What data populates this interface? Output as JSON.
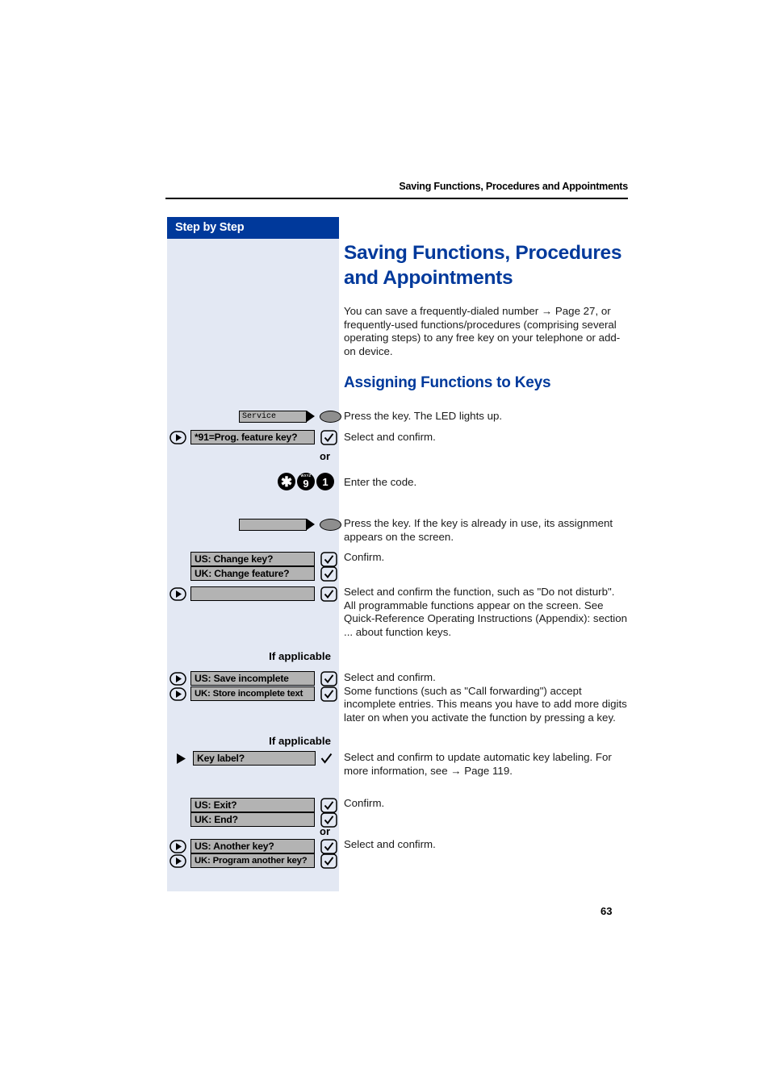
{
  "page": {
    "running_head": "Saving Functions, Procedures and Appointments",
    "number": "63",
    "colors": {
      "accent_blue": "#00399B",
      "sidebar_bg": "#E3E8F3",
      "display_gray": "#B3B3B3"
    }
  },
  "sidebar": {
    "header_label": "Step by Step",
    "or_1": "or",
    "or_2": "or",
    "if_applicable_1": "If applicable",
    "if_applicable_2": "If applicable",
    "service_key_label": "Service",
    "rows": {
      "prog_feature_key": "*91=Prog. feature key?",
      "blank_key": "",
      "us_change_key": "US: Change key?",
      "uk_change_feature": "UK: Change feature?",
      "blank_function": "",
      "us_save_incomplete": "US: Save incomplete",
      "uk_store_incomplete_text": "UK: Store incomplete text",
      "key_label": "Key label?",
      "us_exit": "US: Exit?",
      "uk_end": "UK: End?",
      "us_another_key": "US: Another key?",
      "uk_program_another_key": "UK: Program another key?"
    },
    "dial_keys": [
      {
        "glyph": "✱",
        "sup": ""
      },
      {
        "glyph": "9",
        "sup": "WXYZ"
      },
      {
        "glyph": "1",
        "sup": ""
      }
    ]
  },
  "main": {
    "title": "Saving Functions, Procedures and Appointments",
    "intro": "You can save a frequently-dialed number → Page 27, or frequently-used functions/procedures (comprising several operating steps) to any free key on your telephone or add-on device.",
    "section_heading": "Assigning Functions to Keys",
    "steps": {
      "press_key_led": "Press the key. The LED lights up.",
      "select_confirm_1": "Select and confirm.",
      "enter_code": "Enter the code.",
      "press_key_assignment": "Press the key. If the key is already in use, its assignment appears on the screen.",
      "confirm_1": "Confirm.",
      "select_confirm_function": "Select and confirm the function, such as \"Do not disturb\".\nAll programmable functions appear on the screen. See Quick-Reference Operating Instructions (Appendix): section ... about function keys.",
      "select_confirm_incomplete": "Select and confirm.\nSome functions (such as \"Call forwarding\") accept incomplete entries. This means you have to add more digits later on when you activate the function by pressing a key.",
      "select_confirm_key_label": "Select and confirm to update automatic key labeling. For more information, see → Page 119.",
      "confirm_2": "Confirm.",
      "select_confirm_2": "Select and confirm."
    }
  }
}
